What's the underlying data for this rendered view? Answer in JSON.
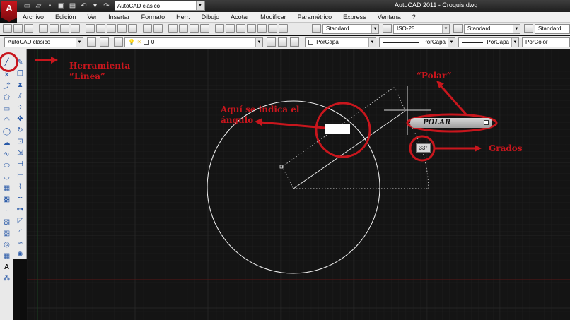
{
  "titlebar": {
    "logo_letter": "A",
    "workspace": "AutoCAD clásico",
    "window_title": "AutoCAD 2011 - Croquis.dwg"
  },
  "menu": {
    "items": [
      "Archivo",
      "Edición",
      "Ver",
      "Insertar",
      "Formato",
      "Herr.",
      "Dibujo",
      "Acotar",
      "Modificar",
      "Paramétrico",
      "Express",
      "Ventana",
      "?"
    ]
  },
  "toolbar1": {
    "text_style": "Standard",
    "dim_style": "ISO-25",
    "table_style": "Standard",
    "multileader_style": "Standard"
  },
  "toolbar2": {
    "workspace": "AutoCAD clásico",
    "layer": "0",
    "color": "PorCapa",
    "linetype": "PorCapa",
    "lineweight": "PorCapa",
    "plotstyle": "PorColor"
  },
  "annotations": {
    "tool_label_line1": "Herramienta",
    "tool_label_line2": "“Linea”",
    "polar_label": "“Polar”",
    "angle_label_line1": "Aquí se indica el",
    "angle_label_line2": "ángulo",
    "degrees_label": "Grados"
  },
  "status": {
    "polar_badge": "POLAR",
    "angle_value": "33°"
  },
  "colors": {
    "annotation_red": "#c8161d",
    "canvas_bg": "#141414",
    "grid_line": "#262626",
    "geometry": "#e8e8e8"
  }
}
